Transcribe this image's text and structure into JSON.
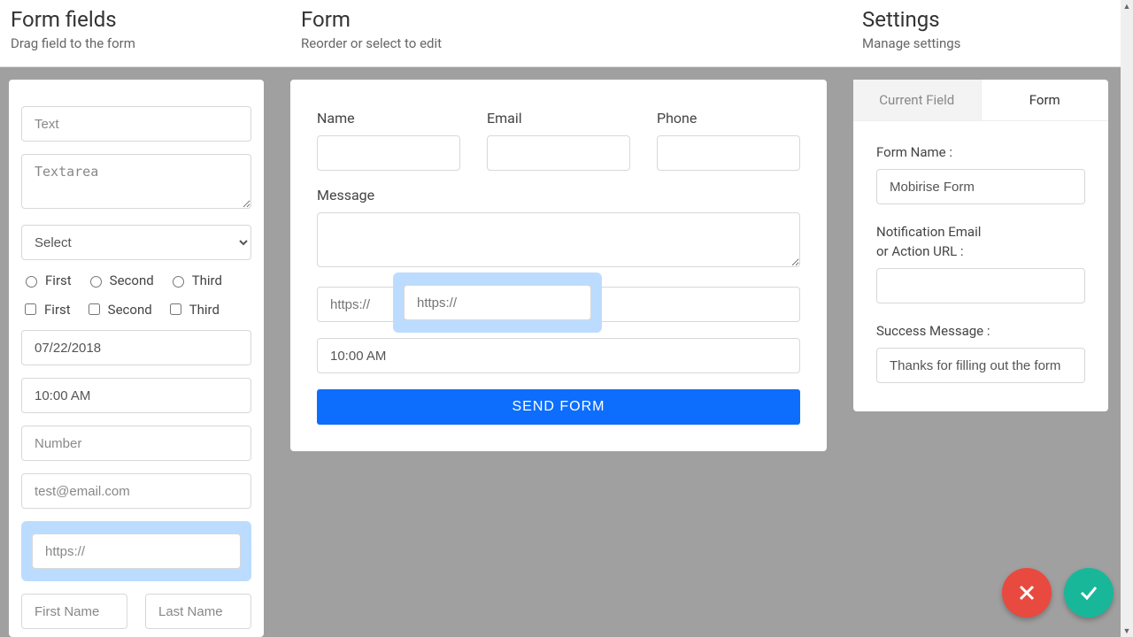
{
  "header": {
    "fields_title": "Form fields",
    "fields_sub": "Drag field to the form",
    "form_title": "Form",
    "form_sub": "Reorder or select to edit",
    "settings_title": "Settings",
    "settings_sub": "Manage settings"
  },
  "fields": {
    "text_placeholder": "Text",
    "textarea_placeholder": "Textarea",
    "select_value": "Select",
    "radio_options": {
      "a": "First",
      "b": "Second",
      "c": "Third"
    },
    "check_options": {
      "a": "First",
      "b": "Second",
      "c": "Third"
    },
    "date_value": "07/22/2018",
    "time_value": "10:00 AM",
    "number_placeholder": "Number",
    "email_placeholder": "test@email.com",
    "url_placeholder": "https://",
    "firstname_placeholder": "First Name",
    "lastname_placeholder": "Last Name"
  },
  "form": {
    "name_label": "Name",
    "email_label": "Email",
    "phone_label": "Phone",
    "message_label": "Message",
    "url_placeholder": "https://",
    "drag_url_placeholder": "https://",
    "time_value": "10:00 AM",
    "send_label": "SEND FORM"
  },
  "settings": {
    "tab_current": "Current Field",
    "tab_form": "Form",
    "form_name_label": "Form Name :",
    "form_name_value": "Mobirise Form",
    "notif_label_1": "Notification Email",
    "notif_label_2": "or Action URL :",
    "success_label": "Success Message :",
    "success_value": "Thanks for filling out the form"
  }
}
